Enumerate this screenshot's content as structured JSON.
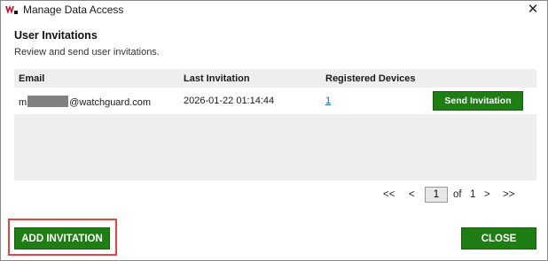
{
  "window": {
    "title": "Manage Data Access",
    "close_glyph": "✕"
  },
  "section": {
    "title": "User Invitations",
    "subtitle": "Review and send user invitations."
  },
  "table": {
    "columns": [
      "Email",
      "Last Invitation",
      "Registered Devices"
    ],
    "rows": [
      {
        "email_prefix": "m",
        "email_suffix": "@watchguard.com",
        "last_invitation": "2026-01-22 01:14:44",
        "registered_devices": "1",
        "action_label": "Send Invitation"
      }
    ]
  },
  "pager": {
    "first": "<<",
    "prev": "<",
    "current_page": "1",
    "of_label": "of",
    "total_pages": "1",
    "next": ">",
    "last": ">>"
  },
  "footer": {
    "add_label": "ADD INVITATION",
    "close_label": "CLOSE"
  },
  "colors": {
    "accent_green": "#1e7d13",
    "highlight_red": "#e04646",
    "brand_red": "#c8102e"
  }
}
